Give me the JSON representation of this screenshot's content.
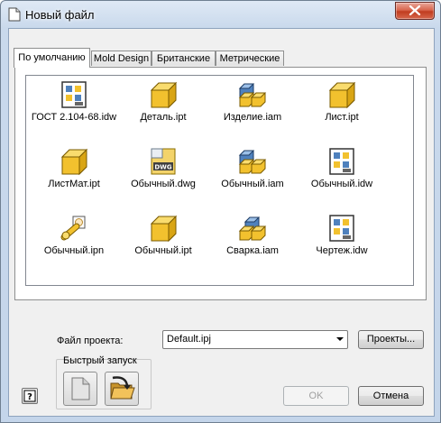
{
  "window": {
    "title": "Новый файл",
    "close_label": "×"
  },
  "tabs": [
    {
      "label": "По умолчанию",
      "active": true
    },
    {
      "label": "Mold Design",
      "active": false
    },
    {
      "label": "Британские",
      "active": false
    },
    {
      "label": "Метрические",
      "active": false
    }
  ],
  "files": [
    {
      "name": "ГОСТ 2.104-68.idw",
      "icon": "drawing-idw-icon"
    },
    {
      "name": "Деталь.ipt",
      "icon": "part-ipt-icon"
    },
    {
      "name": "Изделие.iam",
      "icon": "assembly-iam-icon"
    },
    {
      "name": "Лист.ipt",
      "icon": "sheetmetal-ipt-icon"
    },
    {
      "name": "ЛистМат.ipt",
      "icon": "sheetmetal-ipt-icon"
    },
    {
      "name": "Обычный.dwg",
      "icon": "dwg-icon"
    },
    {
      "name": "Обычный.iam",
      "icon": "assembly-iam-icon"
    },
    {
      "name": "Обычный.idw",
      "icon": "drawing-idw-icon"
    },
    {
      "name": "Обычный.ipn",
      "icon": "presentation-ipn-icon"
    },
    {
      "name": "Обычный.ipt",
      "icon": "part-ipt-icon"
    },
    {
      "name": "Сварка.iam",
      "icon": "weldment-iam-icon"
    },
    {
      "name": "Чертеж.idw",
      "icon": "drawing-idw-icon"
    }
  ],
  "project": {
    "label": "Файл проекта:",
    "value": "Default.ipj",
    "projects_button": "Проекты..."
  },
  "quick_launch": {
    "label": "Быстрый запуск",
    "new_icon": "blank-document-icon",
    "open_icon": "open-folder-icon"
  },
  "buttons": {
    "help": "?",
    "ok": "OK",
    "cancel": "Отмена"
  },
  "colors": {
    "part_yellow": "#f2c12e",
    "assembly_blue": "#4f81bd",
    "close_red": "#c74f33"
  }
}
